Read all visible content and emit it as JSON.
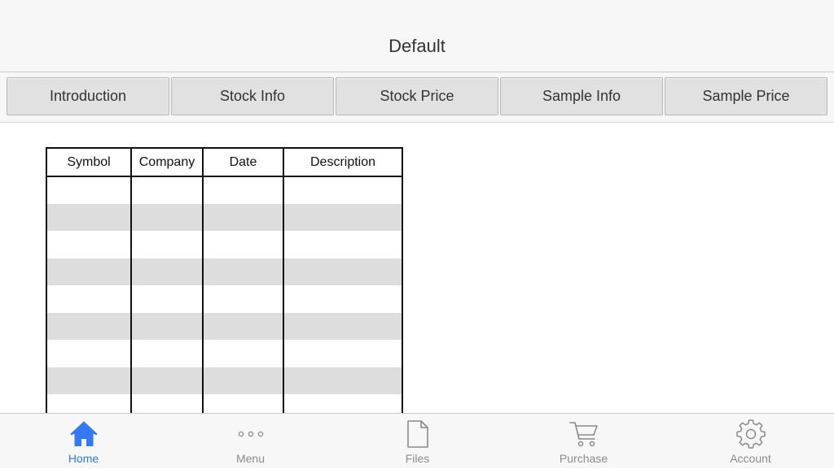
{
  "header": {
    "title": "Default"
  },
  "tabs": [
    {
      "label": "Introduction"
    },
    {
      "label": "Stock Info"
    },
    {
      "label": "Stock Price"
    },
    {
      "label": "Sample Info"
    },
    {
      "label": "Sample Price"
    }
  ],
  "table": {
    "columns": [
      "Symbol",
      "Company",
      "Date",
      "Description"
    ],
    "rows": [
      [
        "",
        "",
        "",
        ""
      ],
      [
        "",
        "",
        "",
        ""
      ],
      [
        "",
        "",
        "",
        ""
      ],
      [
        "",
        "",
        "",
        ""
      ],
      [
        "",
        "",
        "",
        ""
      ],
      [
        "",
        "",
        "",
        ""
      ],
      [
        "",
        "",
        "",
        ""
      ],
      [
        "",
        "",
        "",
        ""
      ],
      [
        "",
        "",
        "",
        ""
      ]
    ]
  },
  "bottom_nav": {
    "active_color": "#3478f6",
    "inactive_color": "#8a8a8a",
    "items": [
      {
        "label": "Home",
        "icon": "home-icon",
        "active": true
      },
      {
        "label": "Menu",
        "icon": "more-icon",
        "active": false
      },
      {
        "label": "Files",
        "icon": "file-icon",
        "active": false
      },
      {
        "label": "Purchase",
        "icon": "cart-icon",
        "active": false
      },
      {
        "label": "Account",
        "icon": "gear-icon",
        "active": false
      }
    ]
  }
}
